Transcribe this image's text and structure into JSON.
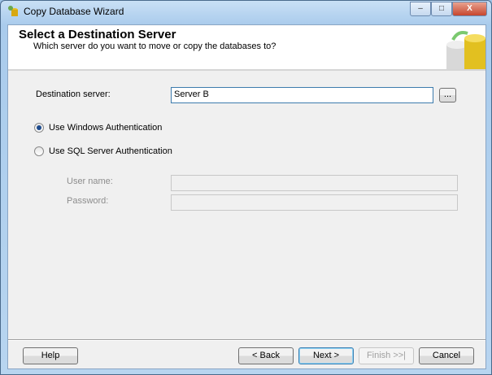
{
  "window": {
    "title": "Copy Database Wizard",
    "minimize": "–",
    "maximize": "□",
    "close": "X"
  },
  "header": {
    "title": "Select a Destination Server",
    "subtitle": "Which server do you want to move or copy the databases to?"
  },
  "form": {
    "destination_label": "Destination server:",
    "destination_value": "Server B",
    "browse_label": "...",
    "windows_auth": "Use Windows Authentication",
    "sql_auth": "Use SQL Server Authentication",
    "username_label": "User name:",
    "username_value": "",
    "password_label": "Password:",
    "password_value": ""
  },
  "footer": {
    "help": "Help",
    "back": "< Back",
    "next": "Next >",
    "finish": "Finish >>|",
    "cancel": "Cancel"
  }
}
